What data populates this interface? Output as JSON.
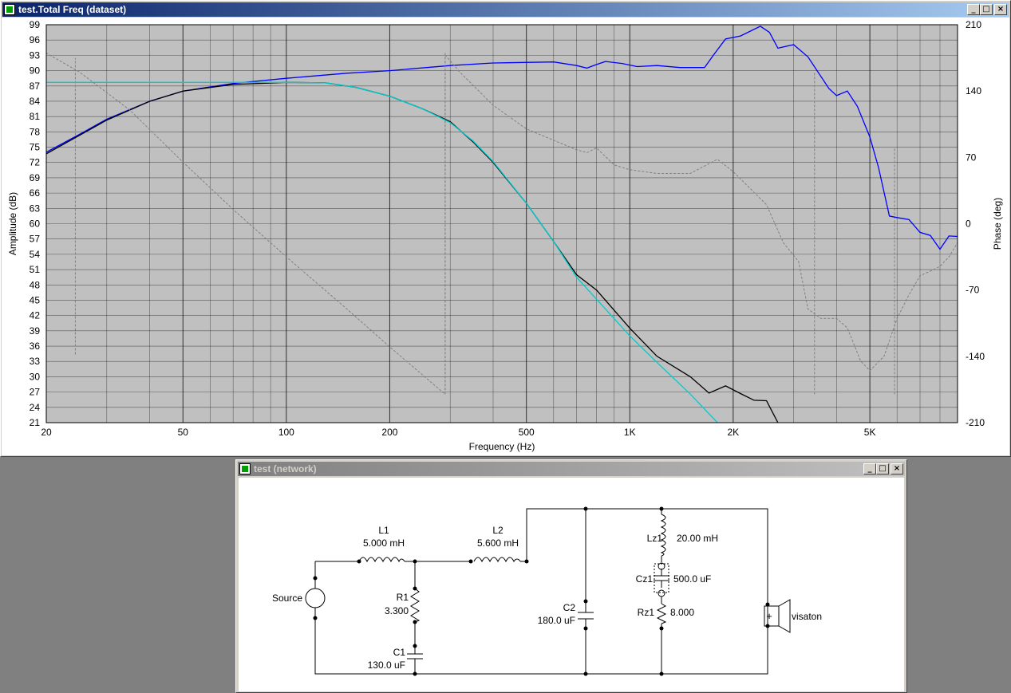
{
  "freq_window": {
    "title": "test.Total Freq (dataset)",
    "buttons": {
      "minimize": "_",
      "maximize": "□",
      "close": "×"
    }
  },
  "network_window": {
    "title": "test (network)",
    "buttons": {
      "minimize": "_",
      "maximize": "□",
      "close": "×"
    }
  },
  "chart_data": {
    "type": "line",
    "xlabel": "Frequency (Hz)",
    "ylabel": "Amplitude (dB)",
    "y2label": "Phase (deg)",
    "xscale": "log",
    "xlim": [
      20,
      9000
    ],
    "ylim": [
      21,
      99
    ],
    "y2lim": [
      -210,
      210
    ],
    "xticks": [
      {
        "v": 20,
        "label": "20"
      },
      {
        "v": 50,
        "label": "50"
      },
      {
        "v": 100,
        "label": "100"
      },
      {
        "v": 200,
        "label": "200"
      },
      {
        "v": 500,
        "label": "500"
      },
      {
        "v": 1000,
        "label": "1K"
      },
      {
        "v": 2000,
        "label": "2K"
      },
      {
        "v": 5000,
        "label": "5K"
      }
    ],
    "yticks": [
      21,
      24,
      27,
      30,
      33,
      36,
      39,
      42,
      45,
      48,
      51,
      54,
      57,
      60,
      63,
      66,
      69,
      72,
      75,
      78,
      81,
      84,
      87,
      90,
      93,
      96,
      99
    ],
    "y2ticks": [
      210,
      140,
      70,
      0,
      -70,
      -140,
      -210
    ],
    "grid": true,
    "series": [
      {
        "color": "#0000ff",
        "axis": "y",
        "points": [
          [
            20,
            74
          ],
          [
            25,
            77.5
          ],
          [
            30,
            80.5
          ],
          [
            40,
            84
          ],
          [
            50,
            86
          ],
          [
            70,
            87.5
          ],
          [
            100,
            88.5
          ],
          [
            150,
            89.5
          ],
          [
            200,
            90
          ],
          [
            300,
            91
          ],
          [
            400,
            91.5
          ],
          [
            600,
            91.7
          ],
          [
            700,
            91
          ],
          [
            750,
            90.5
          ],
          [
            800,
            91.2
          ],
          [
            850,
            91.8
          ],
          [
            950,
            91.4
          ],
          [
            1050,
            90.8
          ],
          [
            1200,
            91
          ],
          [
            1400,
            90.6
          ],
          [
            1650,
            90.6
          ],
          [
            1750,
            93
          ],
          [
            1900,
            96.2
          ],
          [
            2100,
            96.8
          ],
          [
            2400,
            98.7
          ],
          [
            2550,
            97.5
          ],
          [
            2700,
            94.4
          ],
          [
            3000,
            95.1
          ],
          [
            3300,
            92.7
          ],
          [
            3800,
            86.5
          ],
          [
            4000,
            85.1
          ],
          [
            4300,
            86
          ],
          [
            4600,
            83
          ],
          [
            5000,
            77
          ],
          [
            5300,
            71
          ],
          [
            5700,
            61.5
          ],
          [
            6000,
            61.2
          ],
          [
            6500,
            60.8
          ],
          [
            7000,
            58.3
          ],
          [
            7500,
            57.7
          ],
          [
            8000,
            55
          ],
          [
            8500,
            57.6
          ],
          [
            9000,
            57.5
          ]
        ]
      },
      {
        "color": "#000000",
        "axis": "y",
        "points": [
          [
            20,
            73.7
          ],
          [
            30,
            80.3
          ],
          [
            40,
            84
          ],
          [
            50,
            86
          ],
          [
            70,
            87.3
          ],
          [
            100,
            87.7
          ],
          [
            130,
            87.6
          ],
          [
            160,
            86.7
          ],
          [
            200,
            85
          ],
          [
            250,
            82.5
          ],
          [
            300,
            80
          ],
          [
            350,
            76
          ],
          [
            400,
            72
          ],
          [
            500,
            64
          ],
          [
            600,
            56.5
          ],
          [
            700,
            50
          ],
          [
            800,
            47
          ],
          [
            1000,
            39.5
          ],
          [
            1200,
            34
          ],
          [
            1500,
            30
          ],
          [
            1700,
            26.8
          ],
          [
            1900,
            28.2
          ],
          [
            2100,
            26.7
          ],
          [
            2300,
            25.4
          ],
          [
            2500,
            25.3
          ],
          [
            2700,
            21
          ]
        ]
      },
      {
        "color": "#00cccc",
        "axis": "y",
        "points": [
          [
            20,
            87.7
          ],
          [
            100,
            87.7
          ],
          [
            130,
            87.6
          ],
          [
            160,
            86.7
          ],
          [
            200,
            85
          ],
          [
            250,
            82.5
          ],
          [
            300,
            79.8
          ],
          [
            350,
            76.2
          ],
          [
            400,
            72.2
          ],
          [
            500,
            64
          ],
          [
            600,
            56.5
          ],
          [
            700,
            49.5
          ],
          [
            1000,
            38
          ],
          [
            1200,
            32.8
          ],
          [
            1500,
            26.6
          ],
          [
            1800,
            21
          ]
        ]
      },
      {
        "color": "#808080",
        "axis": "y2",
        "dash": "3,2",
        "points": [
          [
            20,
            210
          ],
          [
            20,
            180
          ],
          [
            25,
            160
          ],
          [
            35,
            120
          ],
          [
            50,
            65
          ],
          [
            70,
            15
          ],
          [
            100,
            -35
          ],
          [
            150,
            -90
          ],
          [
            200,
            -130
          ],
          [
            290,
            -180
          ],
          [
            290,
            178
          ],
          [
            320,
            160
          ],
          [
            400,
            125
          ],
          [
            500,
            100
          ],
          [
            700,
            78
          ],
          [
            750,
            75
          ],
          [
            800,
            80
          ],
          [
            900,
            62
          ],
          [
            1000,
            57
          ],
          [
            1200,
            53
          ],
          [
            1500,
            53
          ],
          [
            1800,
            68
          ],
          [
            2000,
            55
          ],
          [
            2500,
            20
          ],
          [
            2800,
            -20
          ],
          [
            3100,
            -40
          ],
          [
            3300,
            -90
          ],
          [
            3600,
            -100
          ],
          [
            3800,
            -100
          ],
          [
            4000,
            -100
          ],
          [
            4300,
            -110
          ],
          [
            4700,
            -145
          ],
          [
            5000,
            -155
          ],
          [
            5500,
            -140
          ],
          [
            6000,
            -100
          ],
          [
            6500,
            -75
          ],
          [
            7000,
            -55
          ],
          [
            7500,
            -50
          ],
          [
            8000,
            -45
          ],
          [
            8500,
            -35
          ],
          [
            9000,
            -20
          ]
        ]
      }
    ],
    "markers": [
      {
        "f": 24.3,
        "from": -138,
        "to": 175
      },
      {
        "f": 290,
        "from": -180,
        "to": 180
      },
      {
        "f": 3450,
        "from": -180,
        "to": 160
      },
      {
        "f": 5900,
        "from": -180,
        "to": 80
      }
    ]
  },
  "schematic": {
    "components": {
      "L1": {
        "name": "L1",
        "value": "5.000 mH"
      },
      "L2": {
        "name": "L2",
        "value": "5.600 mH"
      },
      "R1": {
        "name": "R1",
        "value": "3.300"
      },
      "C1": {
        "name": "C1",
        "value": "130.0 uF"
      },
      "C2": {
        "name": "C2",
        "value": "180.0 uF"
      },
      "Lz1": {
        "name": "Lz1",
        "value": "20.00 mH"
      },
      "Cz1": {
        "name": "Cz1",
        "value": "500.0 uF"
      },
      "Rz1": {
        "name": "Rz1",
        "value": "8.000"
      },
      "source": {
        "name": "Source"
      },
      "driver": {
        "name": "visaton",
        "polarity": "+"
      }
    }
  }
}
